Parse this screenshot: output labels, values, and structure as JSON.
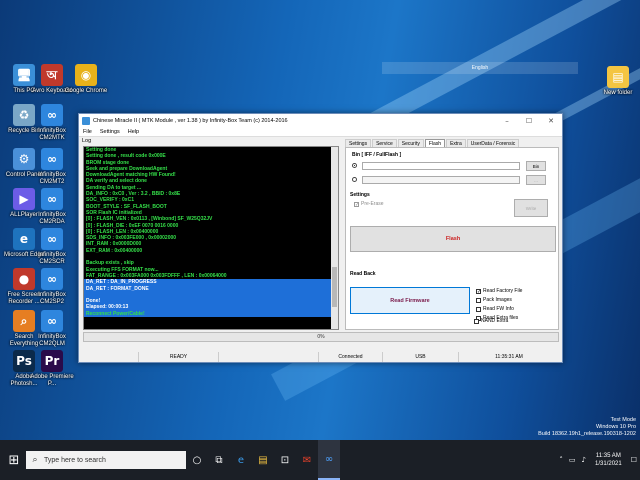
{
  "desktop": {
    "icons": [
      {
        "name": "this-pc",
        "label": "This PC",
        "glyph": "🖥",
        "color": "#3a8fd8"
      },
      {
        "name": "avro-keyboard",
        "label": "Avro Keyboard",
        "glyph": "অ",
        "color": "#c0392b"
      },
      {
        "name": "google-chrome",
        "label": "Google Chrome",
        "glyph": "◉",
        "color": "#e8b21a"
      },
      {
        "name": "recycle-bin",
        "label": "Recycle Bin",
        "glyph": "♻",
        "color": "#7aa7c7"
      },
      {
        "name": "infinitybox-cm2mtk",
        "label": "InfinityBox CM2MTK",
        "glyph": "∞",
        "color": "#2e86de"
      },
      {
        "name": "control-panel",
        "label": "Control Panel",
        "glyph": "⚙",
        "color": "#4a90d9"
      },
      {
        "name": "infinitybox-cm2mt2",
        "label": "InfinityBox CM2MT2",
        "glyph": "∞",
        "color": "#2e86de"
      },
      {
        "name": "all-player",
        "label": "ALLPlayer",
        "glyph": "▶",
        "color": "#6c5ce7"
      },
      {
        "name": "infinitybox-cm2rda",
        "label": "InfinityBox CM2RDA",
        "glyph": "∞",
        "color": "#2e86de"
      },
      {
        "name": "microsoft-edge",
        "label": "Microsoft Edge",
        "glyph": "e",
        "color": "#1e73be"
      },
      {
        "name": "infinitybox-cm2scr",
        "label": "InfinityBox CM2SCR",
        "glyph": "∞",
        "color": "#2e86de"
      },
      {
        "name": "free-screen-recorder",
        "label": "Free Screen Recorder ...",
        "glyph": "●",
        "color": "#c0392b"
      },
      {
        "name": "infinitybox-cm2sp2",
        "label": "InfinityBox CM2SP2",
        "glyph": "∞",
        "color": "#2e86de"
      },
      {
        "name": "search-everything",
        "label": "Search Everything",
        "glyph": "⌕",
        "color": "#e67e22"
      },
      {
        "name": "infinitybox-cm2qlm",
        "label": "InfinityBox CM2QLM",
        "glyph": "∞",
        "color": "#2e86de"
      },
      {
        "name": "adobe-photoshop",
        "label": "Adobe Photosh...",
        "glyph": "Ps",
        "color": "#0b2a4a"
      },
      {
        "name": "adobe-premiere",
        "label": "Adobe Premiere P...",
        "glyph": "Pr",
        "color": "#2a0b4a"
      },
      {
        "name": "new-folder",
        "label": "New folder",
        "glyph": "▤",
        "color": "#f4c542"
      }
    ],
    "watermark": {
      "line1": "Test Mode",
      "line2": "Windows 10 Pro",
      "line3": "Build 18362.19h1_release.190318-1202"
    },
    "top_strip": {
      "lang": "English",
      "items": [
        "English"
      ]
    }
  },
  "window": {
    "title": "Chinese Miracle II ( MTK Module , ver 1.38 ) by Infinity-Box Team (c) 2014-2016",
    "menu": [
      "File",
      "Settings",
      "Help"
    ],
    "log_label": "Log",
    "log_lines": [
      {
        "text": "Setting done",
        "style": ""
      },
      {
        "text": "Setting done , result code 0x000E",
        "style": ""
      },
      {
        "text": "BROM stage done",
        "style": ""
      },
      {
        "text": "Seek and prepare DownloadAgent",
        "style": ""
      },
      {
        "text": "DownloadAgent matching HW Found!",
        "style": ""
      },
      {
        "text": "DA verify and select done",
        "style": ""
      },
      {
        "text": "Sending DA to target ...",
        "style": ""
      },
      {
        "text": "DA_INFO : 0xC0 , Ver : 3.2 , BBID : 0x8E",
        "style": ""
      },
      {
        "text": "SOC_VERIFY : 0xC1",
        "style": ""
      },
      {
        "text": "BOOT_STYLE : SF_FLASH_BOOT",
        "style": ""
      },
      {
        "text": "SOR Flash IC initialized",
        "style": ""
      },
      {
        "text": "[0] : FLASH_VEN : 0x0113 , [Winbond] SF_W25Q32JV",
        "style": ""
      },
      {
        "text": "[0] : FLASH_DIE : 0xEF 0070 0016 0000",
        "style": ""
      },
      {
        "text": "[0] : FLASH_LEN : 0x00400000",
        "style": ""
      },
      {
        "text": "SDS_INFO : 0x003FE000 , 0x00002000",
        "style": ""
      },
      {
        "text": "INT_RAM : 0x0000D000",
        "style": ""
      },
      {
        "text": "EXT_RAM : 0x00400000",
        "style": ""
      },
      {
        "text": "",
        "style": ""
      },
      {
        "text": "Backup exists , skip",
        "style": ""
      },
      {
        "text": "Executing FFS FORMAT now...",
        "style": ""
      },
      {
        "text": "FAT_RANGE : 0x003FA000 0x003FDFFF , LEN : 0x00064000",
        "style": ""
      },
      {
        "text": "DA_RET : DA_IN_PROGRESS",
        "style": "sel"
      },
      {
        "text": "DA_RET : FORMAT_DONE",
        "style": "sel"
      },
      {
        "text": "",
        "style": "sel"
      },
      {
        "text": "Done!",
        "style": "sel"
      },
      {
        "text": "Elapsed: 00:00:13",
        "style": "sel"
      },
      {
        "text": "Reconnect Power/Cable!",
        "style": "selg"
      }
    ],
    "tabs": [
      "Settings",
      "Service",
      "Security",
      "Flash",
      "Extra",
      "UserData / Forensic"
    ],
    "active_tab": "Flash",
    "flash": {
      "bin_label": "Bin  [ IFF / FullFlash ]",
      "bin_button": "Bin",
      "browse_button": "...",
      "settings_label": "Settings",
      "pre_erase_label": "Pre-Erase",
      "side_button": "Write",
      "flash_button": "Flash",
      "flash_color": "#cc2222",
      "readback_label": "Read Back",
      "read_firmware_button": "Read Firmware",
      "read_firmware_color": "#7a1a4a",
      "options": [
        {
          "label": "Read Factory File",
          "checked": true
        },
        {
          "label": "Pack Images",
          "checked": false
        },
        {
          "label": "Read FW Info",
          "checked": false
        },
        {
          "label": "Read Extra files",
          "checked": false
        }
      ],
      "nand_label": "NAND Extra",
      "nand_checked": false
    },
    "progress": {
      "text": "0%",
      "value": 0
    },
    "status": [
      "",
      "READY",
      "",
      "Connected",
      "USB",
      "11:35:31 AM"
    ]
  },
  "taskbar": {
    "search_placeholder": "Type here to search",
    "clock_time": "11:35 AM",
    "clock_date": "1/31/2021"
  }
}
